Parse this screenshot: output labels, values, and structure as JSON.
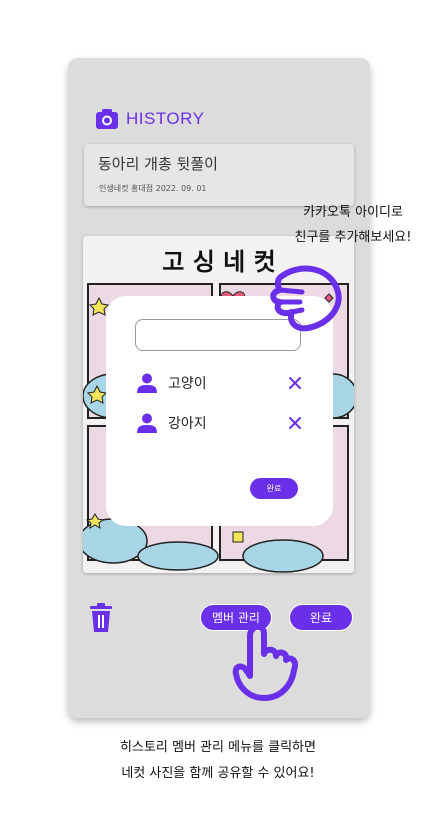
{
  "header": {
    "title": "HISTORY",
    "icon": "camera-icon"
  },
  "entry": {
    "title": "동아리 개총 뒷풀이",
    "subtitle": "인생네컷 홍대점 2022. 09. 01"
  },
  "photo": {
    "caption": "고 싱 네 컷"
  },
  "member_panel": {
    "input_value": "",
    "members": [
      {
        "name": "고양이"
      },
      {
        "name": "강아지"
      }
    ],
    "done_label": "완료"
  },
  "annotations": {
    "top_line1": "카카오톡 아이디로",
    "top_line2": "친구를 추가해보세요!",
    "bottom_line1": "히스토리 멤버 관리 메뉴를 클릭하면",
    "bottom_line2": "네컷 사진을 함께 공유할 수 있어요!"
  },
  "footer": {
    "member_button": "멤버 관리",
    "done_button": "완료"
  },
  "colors": {
    "accent": "#6a2fe8",
    "card": "#dcdcdc",
    "panel": "#ffffff"
  }
}
